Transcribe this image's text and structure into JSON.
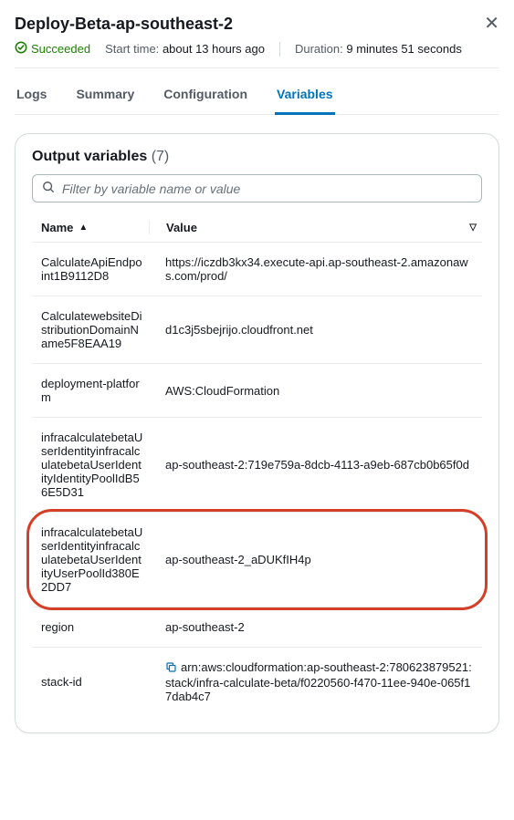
{
  "header": {
    "title": "Deploy-Beta-ap-southeast-2",
    "status_text": "Succeeded",
    "start_label": "Start time:",
    "start_value": "about 13 hours ago",
    "duration_label": "Duration:",
    "duration_value": "9 minutes 51 seconds"
  },
  "tabs": {
    "logs": "Logs",
    "summary": "Summary",
    "configuration": "Configuration",
    "variables": "Variables"
  },
  "card": {
    "title": "Output variables",
    "count": "(7)",
    "filter_placeholder": "Filter by variable name or value",
    "col_name": "Name",
    "col_value": "Value"
  },
  "rows": [
    {
      "name": "CalculateApiEndpoint1B9112D8",
      "value": "https://iczdb3kx34.execute-api.ap-southeast-2.amazonaws.com/prod/"
    },
    {
      "name": "CalculatewebsiteDistributionDomainName5F8EAA19",
      "value": "d1c3j5sbejrijo.cloudfront.net"
    },
    {
      "name": "deployment-platform",
      "value": "AWS:CloudFormation"
    },
    {
      "name": "infracalculatebetaUserIdentityinfracalculatebetaUserIdentityIdentityPoolIdB56E5D31",
      "value": "ap-southeast-2:719e759a-8dcb-4113-a9eb-687cb0b65f0d"
    },
    {
      "name": "infracalculatebetaUserIdentityinfracalculatebetaUserIdentityUserPoolId380E2DD7",
      "value": "ap-southeast-2_aDUKfIH4p"
    },
    {
      "name": "region",
      "value": "ap-southeast-2"
    },
    {
      "name": "stack-id",
      "value": "arn:aws:cloudformation:ap-southeast-2:780623879521:stack/infra-calculate-beta/f0220560-f470-11ee-940e-065f17dab4c7"
    }
  ]
}
